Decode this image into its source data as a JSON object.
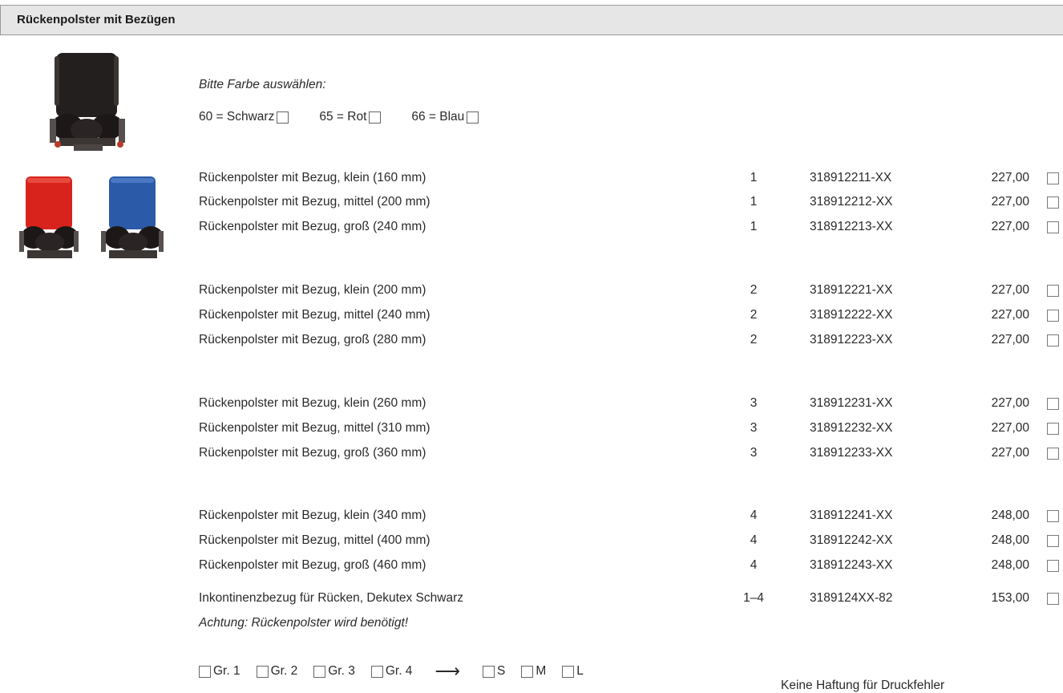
{
  "header": {
    "title": "Rückenpolster mit Bezügen"
  },
  "color_prompt": "Bitte Farbe auswählen:",
  "color_options": [
    {
      "label": "60 = Schwarz"
    },
    {
      "label": "65 = Rot"
    },
    {
      "label": "66 = Blau"
    }
  ],
  "products": [
    {
      "desc": "Rückenpolster mit Bezug, klein (160 mm)",
      "size": "1",
      "artno": "318912211-XX",
      "price": "227,00"
    },
    {
      "desc": "Rückenpolster mit Bezug, mittel (200 mm)",
      "size": "1",
      "artno": "318912212-XX",
      "price": "227,00"
    },
    {
      "desc": "Rückenpolster mit Bezug, groß (240 mm)",
      "size": "1",
      "artno": "318912213-XX",
      "price": "227,00"
    },
    {
      "desc": "Rückenpolster mit Bezug, klein (200 mm)",
      "size": "2",
      "artno": "318912221-XX",
      "price": "227,00"
    },
    {
      "desc": "Rückenpolster mit Bezug, mittel (240 mm)",
      "size": "2",
      "artno": "318912222-XX",
      "price": "227,00"
    },
    {
      "desc": "Rückenpolster mit Bezug, groß (280 mm)",
      "size": "2",
      "artno": "318912223-XX",
      "price": "227,00"
    },
    {
      "desc": "Rückenpolster mit Bezug, klein (260 mm)",
      "size": "3",
      "artno": "318912231-XX",
      "price": "227,00"
    },
    {
      "desc": "Rückenpolster mit Bezug, mittel (310 mm)",
      "size": "3",
      "artno": "318912232-XX",
      "price": "227,00"
    },
    {
      "desc": "Rückenpolster mit Bezug, groß (360 mm)",
      "size": "3",
      "artno": "318912233-XX",
      "price": "227,00"
    },
    {
      "desc": "Rückenpolster mit Bezug, klein (340 mm)",
      "size": "4",
      "artno": "318912241-XX",
      "price": "248,00"
    },
    {
      "desc": "Rückenpolster mit Bezug, mittel (400 mm)",
      "size": "4",
      "artno": "318912242-XX",
      "price": "248,00"
    },
    {
      "desc": "Rückenpolster mit Bezug, groß (460 mm)",
      "size": "4",
      "artno": "318912243-XX",
      "price": "248,00"
    },
    {
      "desc": "Inkontinenzbezug für Rücken, Dekutex Schwarz",
      "size": "1–4",
      "artno": "3189124XX-82",
      "price": "153,00"
    }
  ],
  "warning": "Achtung: Rückenpolster wird benötigt!",
  "size_selector": {
    "groups": [
      "Gr. 1",
      "Gr. 2",
      "Gr. 3",
      "Gr. 4"
    ],
    "arrow": "⟶",
    "sizes": [
      "S",
      "M",
      "L"
    ]
  },
  "footer_note": "Keine Haftung für Druckfehler",
  "colors": {
    "black_cushion": "#231f1e",
    "red_cushion": "#d8231d",
    "blue_cushion": "#2b5aa8",
    "header_bg": "#e6e6e6"
  }
}
